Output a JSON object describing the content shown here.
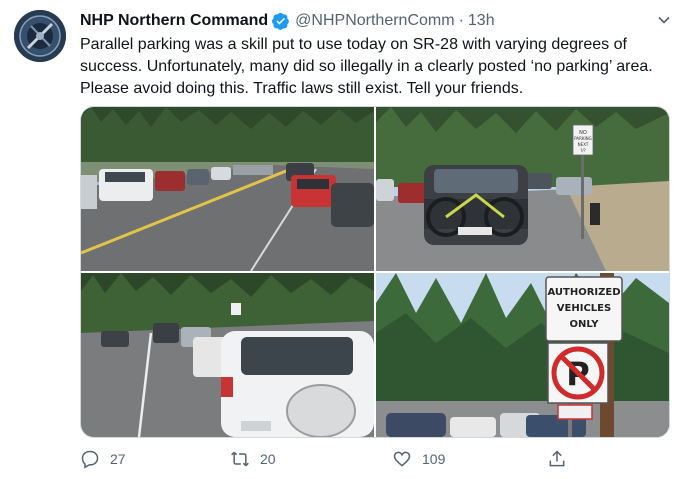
{
  "tweet": {
    "display_name": "NHP Northern Command",
    "handle": "@NHPNorthernComm",
    "separator": "·",
    "time": "13h",
    "text": "Parallel parking was a skill put to use today on SR-28 with varying degrees of success. Unfortunately, many did so illegally in a clearly posted ‘no parking’ area. Please avoid doing this. Traffic laws still exist. Tell your friends.",
    "avatar_icon": "nhp-badge-avatar",
    "verified_icon": "verified-badge-icon"
  },
  "media": {
    "sign_top_right": [
      "NO",
      "PARKING",
      "NEXT",
      "?/?"
    ],
    "sign_bottom_right": [
      "AUTHORIZED",
      "VEHICLES",
      "ONLY"
    ]
  },
  "actions": {
    "reply_count": "27",
    "retweet_count": "20",
    "like_count": "109"
  },
  "colors": {
    "accent": "#1d9bf0",
    "muted": "#536471"
  }
}
